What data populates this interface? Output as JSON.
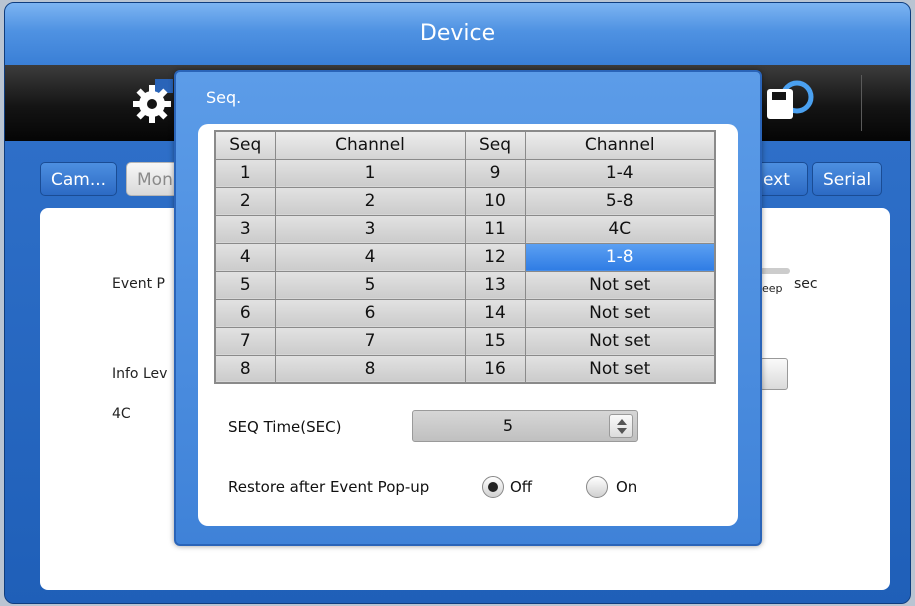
{
  "device": {
    "title": "Device",
    "tabs": [
      {
        "label": "Cam..."
      },
      {
        "label": "Mon"
      },
      {
        "label": "ext"
      },
      {
        "label": "Serial"
      }
    ],
    "background_labels": {
      "event_popup": "Event P",
      "info_level": "Info Lev",
      "mode": "4C",
      "sleep": "eep",
      "sec": "sec"
    }
  },
  "seq_dialog": {
    "title": "Seq.",
    "table": {
      "headers": [
        "Seq",
        "Channel",
        "Seq",
        "Channel"
      ],
      "rows": [
        {
          "seq_a": "1",
          "ch_a": "1",
          "seq_b": "9",
          "ch_b": "1-4"
        },
        {
          "seq_a": "2",
          "ch_a": "2",
          "seq_b": "10",
          "ch_b": "5-8"
        },
        {
          "seq_a": "3",
          "ch_a": "3",
          "seq_b": "11",
          "ch_b": "4C"
        },
        {
          "seq_a": "4",
          "ch_a": "4",
          "seq_b": "12",
          "ch_b": "1-8"
        },
        {
          "seq_a": "5",
          "ch_a": "5",
          "seq_b": "13",
          "ch_b": "Not set"
        },
        {
          "seq_a": "6",
          "ch_a": "6",
          "seq_b": "14",
          "ch_b": "Not set"
        },
        {
          "seq_a": "7",
          "ch_a": "7",
          "seq_b": "15",
          "ch_b": "Not set"
        },
        {
          "seq_a": "8",
          "ch_a": "8",
          "seq_b": "16",
          "ch_b": "Not set"
        }
      ],
      "selected_seq": "12"
    },
    "seq_time": {
      "label": "SEQ Time(SEC)",
      "value": "5"
    },
    "restore": {
      "label": "Restore after Event Pop-up",
      "options": [
        {
          "label": "Off",
          "checked": true
        },
        {
          "label": "On",
          "checked": false
        }
      ]
    }
  },
  "colors": {
    "accent_blue": "#3f82d8",
    "selection_blue": "#2f7ce4",
    "toolbar_dark": "#141414"
  }
}
